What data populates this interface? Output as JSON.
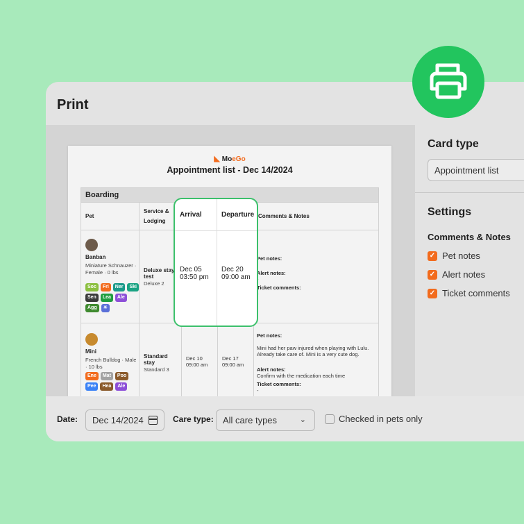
{
  "dialog": {
    "title": "Print"
  },
  "document": {
    "logo_text_a": "Mo",
    "logo_text_b": "Go",
    "title": "Appointment list - Dec 14/2024",
    "section": "Boarding",
    "headers": {
      "pet": "Pet",
      "service": "Service & Lodging",
      "arrival": "Arrival",
      "departure": "Departure",
      "comments": "Comments & Notes"
    },
    "rows": [
      {
        "pet_name": "Banban",
        "pet_desc": "Miniature Schnauzer · Female · 0 lbs",
        "tags": [
          {
            "label": "Soc",
            "color": "#8bbf3f"
          },
          {
            "label": "Fri",
            "color": "#f26b1d"
          },
          {
            "label": "Ner",
            "color": "#1a9a8a"
          },
          {
            "label": "Ski",
            "color": "#1aa383"
          },
          {
            "label": "Sen",
            "color": "#3a3a3a"
          },
          {
            "label": "Lea",
            "color": "#1f9d3e"
          },
          {
            "label": "Ale",
            "color": "#8d4fd8"
          },
          {
            "label": "Agg",
            "color": "#3f8a2f"
          },
          {
            "label": "☀",
            "color": "#5a6fd8"
          }
        ],
        "service": "Deluxe stay test",
        "lodging": "Deluxe 2",
        "arrival_date": "Dec 05",
        "arrival_time": "03:50 pm",
        "departure_date": "Dec 20",
        "departure_time": "09:00 am",
        "pet_notes_label": "Pet notes:",
        "alert_notes_label": "Alert notes:",
        "alert_notes_value": "-",
        "ticket_label": "Ticket comments:",
        "ticket_value": "-"
      },
      {
        "pet_name": "Mini",
        "pet_desc": "French Bulldog · Male · 10 lbs",
        "tags": [
          {
            "label": "Ene",
            "color": "#f26b1d"
          },
          {
            "label": "Mat",
            "color": "#a3a3a3"
          },
          {
            "label": "Poo",
            "color": "#8a5a2b"
          },
          {
            "label": "Pee",
            "color": "#3b82f6"
          },
          {
            "label": "Hea",
            "color": "#8a5a2b"
          },
          {
            "label": "Ale",
            "color": "#8d4fd8"
          }
        ],
        "service": "Standard stay",
        "lodging": "Standard 3",
        "arrival_date": "Dec 10",
        "arrival_time": "09:00 am",
        "departure_date": "Dec 17",
        "departure_time": "09:00 am",
        "pet_notes_label": "Pet notes:",
        "pet_notes_value": "Mini had her paw injured when playing with Lulu. Already take care of. Mini is a very cute dog.",
        "alert_notes_label": "Alert notes:",
        "alert_notes_value": "Confirm with the medication each time",
        "ticket_label": "Ticket comments:",
        "ticket_value": "-"
      }
    ]
  },
  "sidebar": {
    "card_type_title": "Card type",
    "card_type_value": "Appointment list",
    "settings_title": "Settings",
    "comments_title": "Comments & Notes",
    "options": [
      {
        "label": "Pet notes",
        "checked": true
      },
      {
        "label": "Alert notes",
        "checked": true
      },
      {
        "label": "Ticket comments",
        "checked": true
      }
    ]
  },
  "filters": {
    "date_label": "Date:",
    "date_value": "Dec 14/2024",
    "care_type_label": "Care type:",
    "care_type_value": "All care types",
    "checked_in_label": "Checked in pets only"
  },
  "colors": {
    "background": "#a8eabb",
    "accent": "#f26b1d",
    "print_button": "#22c55e",
    "highlight_border": "#3cc06b"
  },
  "icons": {
    "print": "printer-icon",
    "calendar": "calendar-icon",
    "dropdown": "chevron-down-icon"
  }
}
